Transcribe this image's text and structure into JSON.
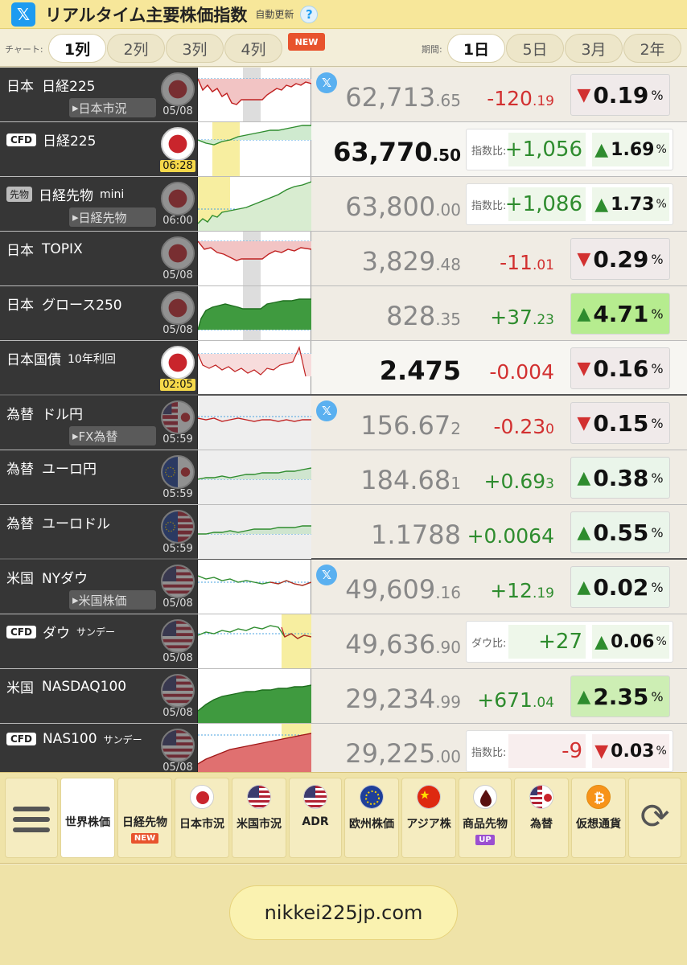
{
  "header": {
    "title": "リアルタイム主要株価指数",
    "subtitle": "自動更新",
    "help": "?",
    "x_glyph": "𝕏"
  },
  "controls": {
    "chart_label": "チャート:",
    "columns": [
      "1列",
      "2列",
      "3列",
      "4列"
    ],
    "new_badge": "NEW",
    "period_label": "期間:",
    "periods": [
      "1日",
      "5日",
      "3月",
      "2年"
    ]
  },
  "rows": [
    {
      "prefix": "日本",
      "name": "日経225",
      "sub": "日本市況",
      "time": "05/08",
      "price_main": "62,713",
      "price_dec": ".65",
      "chg_main": "-120",
      "chg_dec": ".19",
      "pct": "0.19"
    },
    {
      "tag": "CFD",
      "name": "日経225",
      "time": "06:28",
      "price_main": "63,770",
      "price_dec": ".50",
      "cmp_label": "指数比:",
      "chg_main": "+1,056",
      "pct": "1.69"
    },
    {
      "tag": "先物",
      "name": "日経先物",
      "extra": "mini",
      "sub": "日経先物",
      "time": "06:00",
      "price_main": "63,800",
      "price_dec": ".00",
      "cmp_label": "指数比:",
      "chg_main": "+1,086",
      "pct": "1.73"
    },
    {
      "prefix": "日本",
      "name": "TOPIX",
      "time": "05/08",
      "price_main": "3,829",
      "price_dec": ".48",
      "chg_main": "-11",
      "chg_dec": ".01",
      "pct": "0.29"
    },
    {
      "prefix": "日本",
      "name": "グロース250",
      "time": "05/08",
      "price_main": "828",
      "price_dec": ".35",
      "chg_main": "+37",
      "chg_dec": ".23",
      "pct": "4.71"
    },
    {
      "prefix": "日本国債",
      "extra": "10年利回",
      "time": "02:05",
      "price_main": "2.475",
      "chg_main": "-0.004",
      "pct": "0.16"
    },
    {
      "prefix": "為替",
      "name": "ドル円",
      "sub": "FX為替",
      "time": "05:59",
      "price_main": "156.67",
      "price_dec": "2",
      "chg_main": "-0.23",
      "chg_dec": "0",
      "pct": "0.15"
    },
    {
      "prefix": "為替",
      "name": "ユーロ円",
      "time": "05:59",
      "price_main": "184.68",
      "price_dec": "1",
      "chg_main": "+0.69",
      "chg_dec": "3",
      "pct": "0.38"
    },
    {
      "prefix": "為替",
      "name": "ユーロドル",
      "time": "05:59",
      "price_main": "1.1788",
      "chg_main": "+0.0064",
      "pct": "0.55"
    },
    {
      "prefix": "米国",
      "name": "NYダウ",
      "sub": "米国株価",
      "time": "05/08",
      "price_main": "49,609",
      "price_dec": ".16",
      "chg_main": "+12",
      "chg_dec": ".19",
      "pct": "0.02"
    },
    {
      "tag": "CFD",
      "name": "ダウ",
      "extra": "サンデー",
      "time": "05/08",
      "price_main": "49,636",
      "price_dec": ".90",
      "cmp_label": "ダウ比:",
      "chg_main": "+27",
      "pct": "0.06"
    },
    {
      "prefix": "米国",
      "name": "NASDAQ100",
      "time": "05/08",
      "price_main": "29,234",
      "price_dec": ".99",
      "chg_main": "+671",
      "chg_dec": ".04",
      "pct": "2.35"
    },
    {
      "tag": "CFD",
      "name": "NAS100",
      "extra": "サンデー",
      "time": "05/08",
      "price_main": "29,225",
      "price_dec": ".00",
      "cmp_label": "指数比:",
      "chg_main": "-9",
      "pct": "0.03"
    }
  ],
  "pct_unit": "%",
  "nav": {
    "items": [
      {
        "label": "世界株価"
      },
      {
        "label": "日経先物",
        "badge": "NEW"
      },
      {
        "label": "日本市況"
      },
      {
        "label": "米国市況"
      },
      {
        "label": "ADR"
      },
      {
        "label": "欧州株価"
      },
      {
        "label": "アジア株"
      },
      {
        "label": "商品先物",
        "badge": "UP"
      },
      {
        "label": "為替"
      },
      {
        "label": "仮想通貨"
      }
    ],
    "refresh_glyph": "⟳"
  },
  "footer": {
    "url": "nikkei225jp.com"
  },
  "colors": {
    "up": "#2e8c2e",
    "down": "#d23030",
    "header_bg": "#f7e79a",
    "label_bg": "#363636",
    "accent_blue": "#1d9bf0"
  }
}
